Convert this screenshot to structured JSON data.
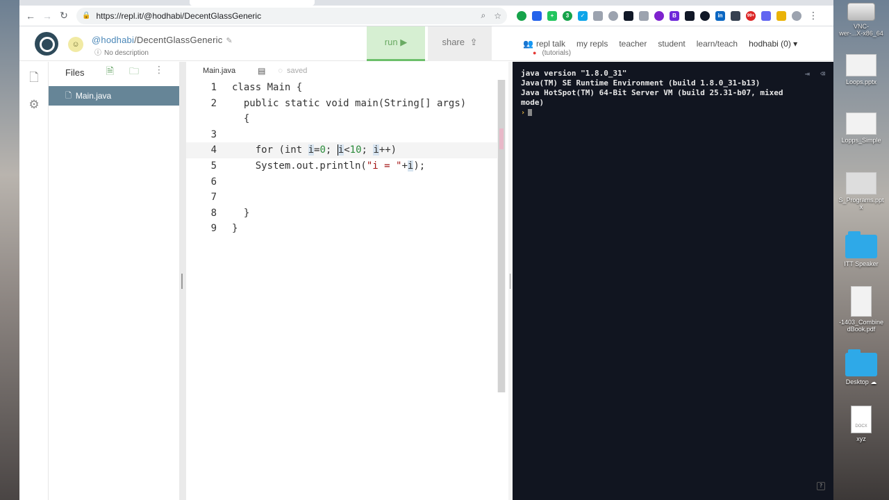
{
  "browser": {
    "url": "https://repl.it/@hodhabi/DecentGlassGeneric",
    "extensions": [
      {
        "name": "grammarly-icon",
        "color": "#16a34a",
        "label": ""
      },
      {
        "name": "blue-circle-icon",
        "color": "#2563eb",
        "label": ""
      },
      {
        "name": "green-plus-icon",
        "color": "#22c55e",
        "label": "+"
      },
      {
        "name": "hangouts-icon",
        "color": "#16a34a",
        "label": "3"
      },
      {
        "name": "check-icon",
        "color": "#0ea5e9",
        "label": "✓"
      },
      {
        "name": "pin-icon",
        "color": "#9ca3af",
        "label": ""
      },
      {
        "name": "drive-icon",
        "color": "#9ca3af",
        "label": ""
      },
      {
        "name": "ext-dark-icon",
        "color": "#111827",
        "label": ""
      },
      {
        "name": "cloud-icon",
        "color": "#9ca3af",
        "label": ""
      },
      {
        "name": "onenote-icon",
        "color": "#7e22ce",
        "label": ""
      },
      {
        "name": "bootstrap-icon",
        "color": "#6d28d9",
        "label": "B"
      },
      {
        "name": "opera-icon",
        "color": "#111827",
        "label": ""
      },
      {
        "name": "qr-icon",
        "color": "#111827",
        "label": ""
      },
      {
        "name": "linkedin-icon",
        "color": "#0a66c2",
        "label": "in"
      },
      {
        "name": "camera-icon",
        "color": "#374151",
        "label": ""
      },
      {
        "name": "mail-badge-icon",
        "color": "#dc2626",
        "label": "99+"
      },
      {
        "name": "blue-hex-icon",
        "color": "#6366f1",
        "label": ""
      },
      {
        "name": "yellow-icon",
        "color": "#eab308",
        "label": ""
      },
      {
        "name": "profile-icon",
        "color": "#9ca3af",
        "label": ""
      }
    ]
  },
  "header": {
    "user": "@hodhabi",
    "repl_name": "/DecentGlassGeneric",
    "description": "No description",
    "run_label": "run ▶",
    "share_label": "share",
    "nav": {
      "repl_talk": "repl talk",
      "tutorials": "(tutorials)",
      "my_repls": "my repls",
      "teacher": "teacher",
      "student": "student",
      "learn_teach": "learn/teach",
      "user_menu": "hodhabi (0) ▾"
    }
  },
  "filetree": {
    "title": "Files",
    "files": [
      "Main.java"
    ]
  },
  "editor": {
    "tab": "Main.java",
    "status": "saved",
    "line_numbers": [
      "1",
      "2",
      "",
      "3",
      "4",
      "5",
      "6",
      "7",
      "8",
      "9"
    ]
  },
  "console": {
    "lines": [
      "java version \"1.8.0_31\"",
      "Java(TM) SE Runtime Environment (build 1.8.0_31-b13)",
      "Java HotSpot(TM) 64-Bit Server VM (build 25.31-b07, mixed",
      "mode)"
    ],
    "prompt": "›"
  },
  "desktop": {
    "icons": [
      "VNC-\nwer-...X-x86_64",
      "Loops.pptx",
      "Lopps_Simple",
      "S_Programs.ppt\nx",
      "ITT Speaker",
      "-1403_Combine\ndBook.pdf",
      "Desktop ☁",
      "xyz"
    ]
  }
}
